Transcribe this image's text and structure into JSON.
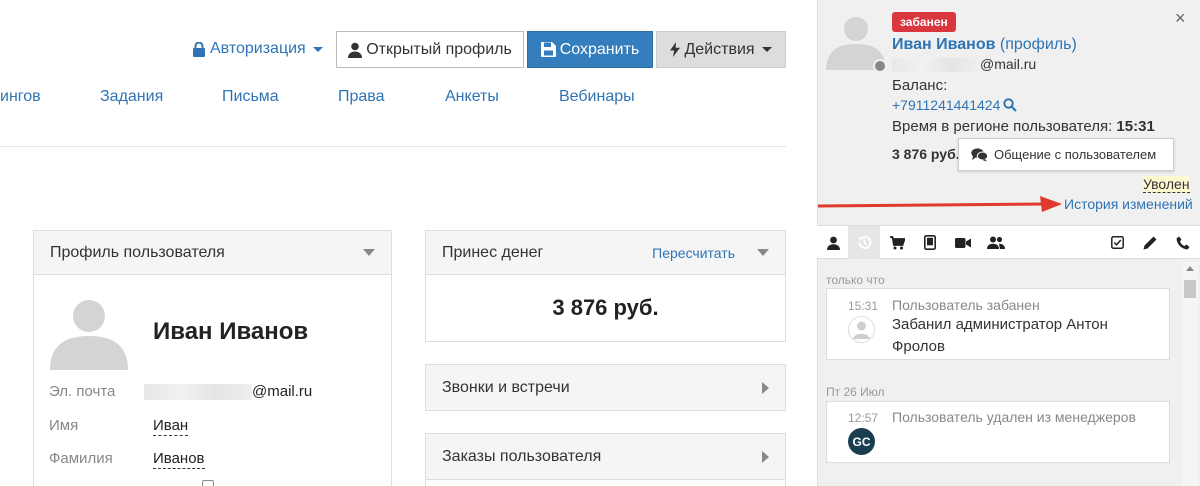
{
  "toolbar": {
    "auth_label": "Авторизация",
    "open_profile_label": "Открытый профиль",
    "save_label": "Сохранить",
    "actions_label": "Действия"
  },
  "nav": {
    "items": [
      {
        "label": "ингов"
      },
      {
        "label": "Задания"
      },
      {
        "label": "Письма"
      },
      {
        "label": "Права"
      },
      {
        "label": "Анкеты"
      },
      {
        "label": "Вебинары"
      }
    ]
  },
  "profile_panel": {
    "title": "Профиль пользователя",
    "name": "Иван Иванов",
    "email_label": "Эл. почта",
    "email_suffix": "@mail.ru",
    "first_name_label": "Имя",
    "first_name": "Иван",
    "last_name_label": "Фамилия",
    "last_name": "Иванов"
  },
  "money_panel": {
    "title": "Принес денег",
    "recalc_label": "Пересчитать",
    "amount": "3 876 руб."
  },
  "calls_panel": {
    "title": "Звонки и встречи"
  },
  "orders_panel": {
    "title": "Заказы пользователя"
  },
  "sidebar": {
    "badge": "забанен",
    "close": "×",
    "name": "Иван Иванов",
    "name_suffix": " (профиль)",
    "email_suffix": "@mail.ru",
    "balance_label": "Баланс:",
    "phone": "+7911241441424",
    "region_time_label": "Время в регионе пользователя: ",
    "region_time": "15:31",
    "amount": "3 876 руб.",
    "chat_label": "Общение с пользователем",
    "fired_label": "Уволен",
    "history_label": "История изменений",
    "accent_color": "#d9363e"
  },
  "feed": [
    {
      "date": "только что",
      "time": "15:31",
      "title": "Пользователь забанен",
      "body": "Забанил администратор Антон Фролов"
    },
    {
      "date": "Пт 26 Июл",
      "time": "12:57",
      "title": "Пользователь удален из менеджеров",
      "avatar_text": "GC"
    }
  ]
}
